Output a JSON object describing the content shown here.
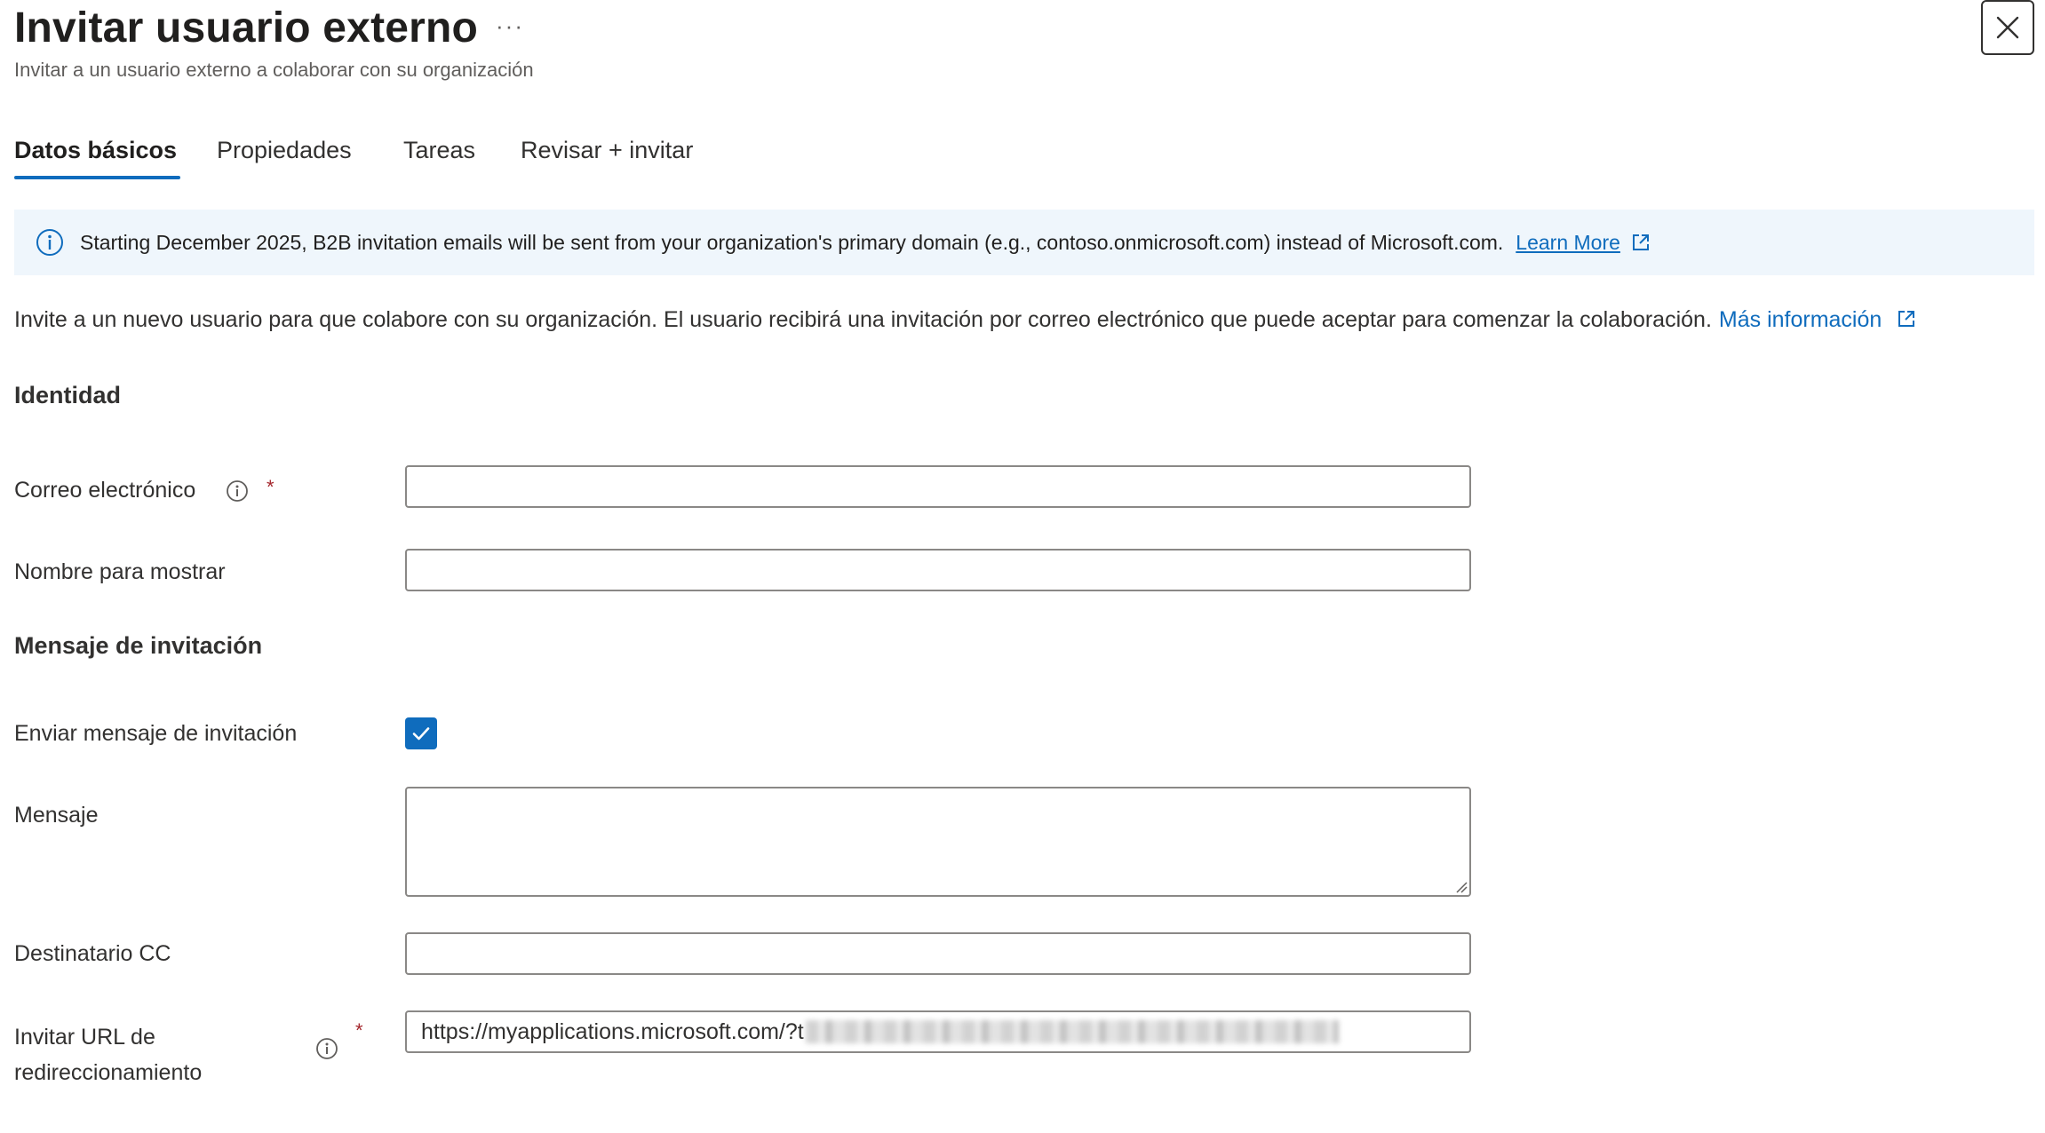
{
  "header": {
    "title": "Invitar usuario externo",
    "more_label": "···",
    "subtitle": "Invitar a un usuario externo a colaborar con su organización"
  },
  "tabs": [
    {
      "label": "Datos básicos",
      "active": true
    },
    {
      "label": "Propiedades",
      "active": false
    },
    {
      "label": "Tareas",
      "active": false
    },
    {
      "label": "Revisar + invitar",
      "active": false
    }
  ],
  "banner": {
    "text": "Starting December 2025, B2B invitation emails will be sent from your organization's primary domain (e.g., contoso.onmicrosoft.com) instead of Microsoft.com.",
    "link": "Learn More"
  },
  "intro": {
    "text": "Invite a un nuevo usuario para que colabore con su organización. El usuario recibirá una invitación por correo electrónico que puede aceptar para comenzar la colaboración.",
    "link": "Más información"
  },
  "identity": {
    "heading": "Identidad",
    "email_label": "Correo electrónico",
    "email_value": "",
    "display_name_label": "Nombre para mostrar",
    "display_name_value": ""
  },
  "invitation": {
    "heading": "Mensaje de invitación",
    "send_label": "Enviar mensaje de invitación",
    "send_checked": true,
    "message_label": "Mensaje",
    "message_value": "",
    "cc_label": "Destinatario CC",
    "cc_value": "",
    "redirect_label_line1": "Invitar URL de",
    "redirect_label_line2": "redireccionamiento",
    "redirect_value": "https://myapplications.microsoft.com/?t"
  },
  "required_mark": "*",
  "colors": {
    "accent": "#0f6cbd",
    "banner_bg": "#eff6fc",
    "required": "#a4262c"
  }
}
